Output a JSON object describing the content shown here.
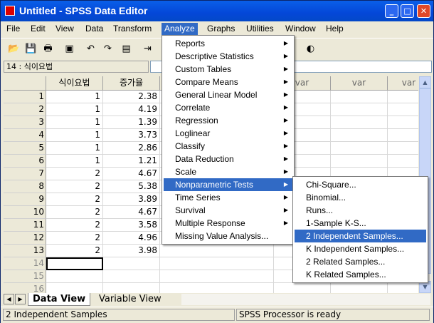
{
  "window": {
    "title": "Untitled - SPSS Data Editor"
  },
  "menubar": [
    "File",
    "Edit",
    "View",
    "Data",
    "Transform",
    "Analyze",
    "Graphs",
    "Utilities",
    "Window",
    "Help"
  ],
  "cell_ref": "14 : 식이요법",
  "columns": [
    "식이요법",
    "증가율",
    "var",
    "var",
    "var"
  ],
  "rows": [
    {
      "n": "1",
      "a": "1",
      "b": "2.38"
    },
    {
      "n": "2",
      "a": "1",
      "b": "4.19"
    },
    {
      "n": "3",
      "a": "1",
      "b": "1.39"
    },
    {
      "n": "4",
      "a": "1",
      "b": "3.73"
    },
    {
      "n": "5",
      "a": "1",
      "b": "2.86"
    },
    {
      "n": "6",
      "a": "1",
      "b": "1.21"
    },
    {
      "n": "7",
      "a": "2",
      "b": "4.67"
    },
    {
      "n": "8",
      "a": "2",
      "b": "5.38"
    },
    {
      "n": "9",
      "a": "2",
      "b": "3.89"
    },
    {
      "n": "10",
      "a": "2",
      "b": "4.67"
    },
    {
      "n": "11",
      "a": "2",
      "b": "3.58"
    },
    {
      "n": "12",
      "a": "2",
      "b": "4.96"
    },
    {
      "n": "13",
      "a": "2",
      "b": "3.98"
    },
    {
      "n": "14",
      "a": "",
      "b": ""
    },
    {
      "n": "15",
      "a": "",
      "b": ""
    },
    {
      "n": "16",
      "a": "",
      "b": ""
    }
  ],
  "analyze_menu": [
    "Reports",
    "Descriptive Statistics",
    "Custom Tables",
    "Compare Means",
    "General Linear Model",
    "Correlate",
    "Regression",
    "Loglinear",
    "Classify",
    "Data Reduction",
    "Scale",
    "Nonparametric Tests",
    "Time Series",
    "Survival",
    "Multiple Response",
    "Missing Value Analysis..."
  ],
  "nonparam_menu": [
    "Chi-Square...",
    "Binomial...",
    "Runs...",
    "1-Sample K-S...",
    "2 Independent Samples...",
    "K Independent Samples...",
    "2 Related Samples...",
    "K Related Samples..."
  ],
  "tabs": {
    "data_view": "Data View",
    "variable_view": "Variable View"
  },
  "status": {
    "left": "2 Independent Samples",
    "right": "SPSS Processor  is ready"
  },
  "colors": {
    "highlight": "#316ac5",
    "titlebar": "#0a5fe8"
  }
}
